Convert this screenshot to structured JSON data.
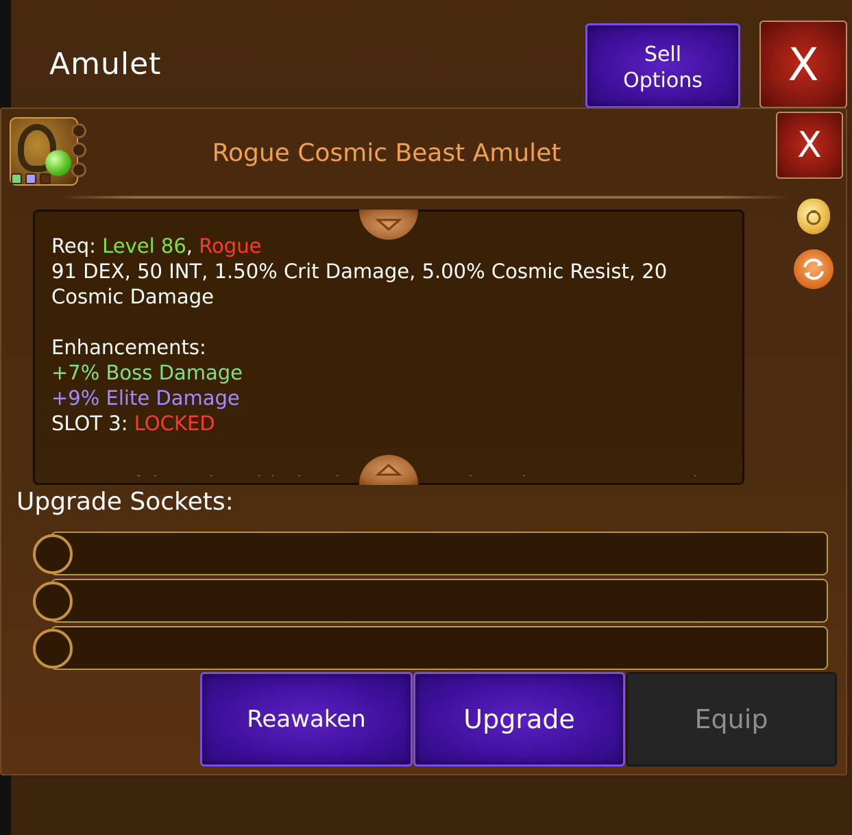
{
  "header": {
    "title": "Amulet",
    "sell_label_line1": "Sell",
    "sell_label_line2": "Options",
    "close_symbol": "X"
  },
  "item": {
    "name": "Rogue Cosmic Beast Amulet",
    "close_symbol": "X",
    "icon": "amulet-icon",
    "slot_colors": [
      "#7cd37a",
      "#a79cff",
      "#5a2e10"
    ],
    "name_color": "#f0a050"
  },
  "description": {
    "req_prefix": "Req: ",
    "req_level": "Level 86",
    "req_sep": ", ",
    "req_class": "Rogue",
    "stats_line1": "91 DEX, 50 INT, 1.50% Crit Damage, 5.00% Cosmic Resist, 20",
    "stats_line2": "Cosmic Damage",
    "enhancements_label": "Enhancements:",
    "enh1": "+7% Boss Damage",
    "enh2": "+9% Elite Damage",
    "slot3_label": "SLOT 3: ",
    "slot3_value": "LOCKED",
    "cut_text": "A powerful amulet with the deadliest reach at the Star Beast rock"
  },
  "side_icons": [
    "money-bag-icon",
    "swap-icon"
  ],
  "sockets": {
    "label": "Upgrade Sockets:",
    "count": 3
  },
  "actions": {
    "reawaken": "Reawaken",
    "upgrade": "Upgrade",
    "equip": "Equip"
  },
  "colors": {
    "purple_button": "#4a14aa",
    "red_close": "#a01e12",
    "level_green": "#7ee340",
    "rogue_red": "#ff3a2a",
    "boss_green": "#84e07e",
    "elite_purple": "#a08cff"
  }
}
